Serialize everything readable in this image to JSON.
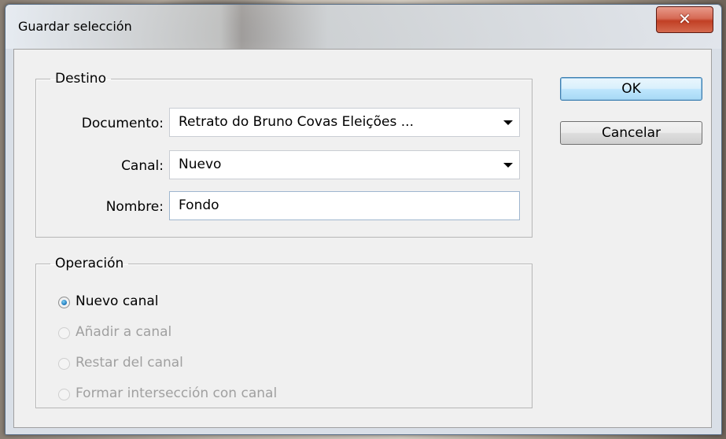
{
  "window": {
    "title": "Guardar selección",
    "close_glyph": "✕"
  },
  "destino": {
    "legend": "Destino",
    "documento_label": "Documento:",
    "documento_value": "Retrato do Bruno Covas Eleições ...",
    "canal_label": "Canal:",
    "canal_value": "Nuevo",
    "nombre_label": "Nombre:",
    "nombre_value": "Fondo"
  },
  "buttons": {
    "ok": "OK",
    "cancel": "Cancelar"
  },
  "operacion": {
    "legend": "Operación",
    "options": [
      {
        "label": "Nuevo canal",
        "checked": true,
        "enabled": true
      },
      {
        "label": "Añadir a canal",
        "checked": false,
        "enabled": false
      },
      {
        "label": "Restar del canal",
        "checked": false,
        "enabled": false
      },
      {
        "label": "Formar intersección con canal",
        "checked": false,
        "enabled": false
      }
    ]
  },
  "colors": {
    "close_button": "#c13f24",
    "default_button_border": "#3c7fb1",
    "radio_checked": "#1a73b8"
  }
}
